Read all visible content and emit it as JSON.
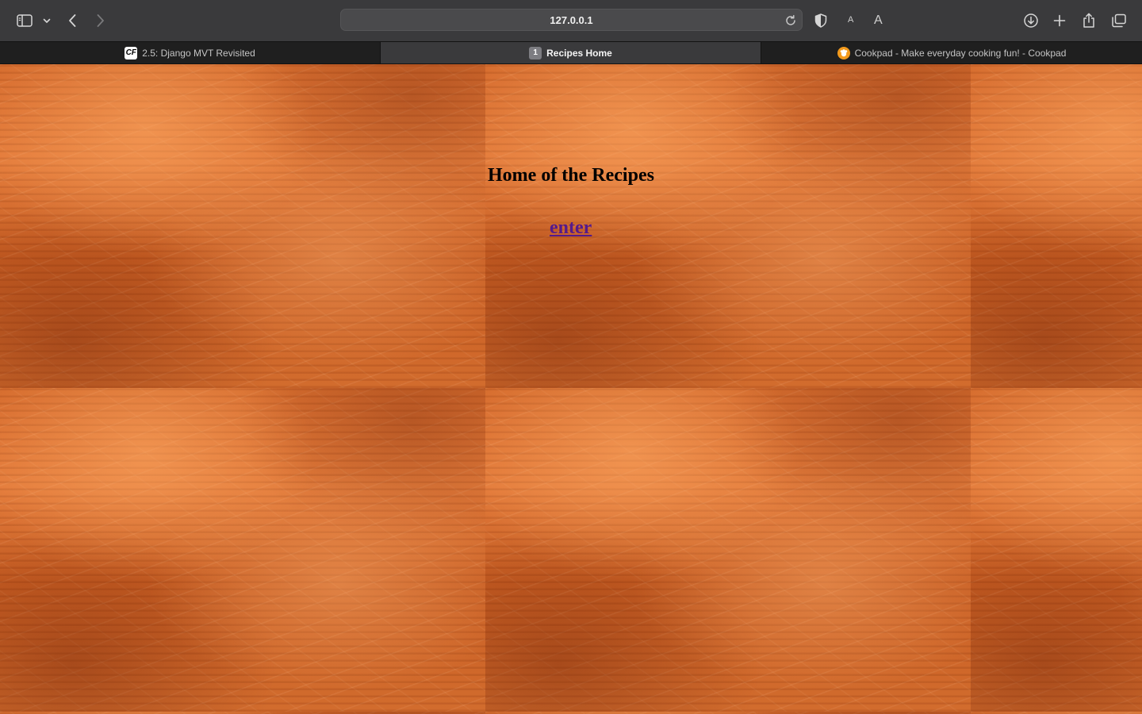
{
  "browser": {
    "address": "127.0.0.1",
    "font_small": "A",
    "font_large": "A"
  },
  "tabs": [
    {
      "label": "2.5: Django MVT Revisited",
      "favicon": "CF",
      "active": false
    },
    {
      "label": "Recipes Home",
      "favicon": "1",
      "active": true
    },
    {
      "label": "Cookpad - Make everyday cooking fun! - Cookpad",
      "favicon": "cookpad-icon",
      "active": false
    }
  ],
  "page": {
    "title": "Home of the Recipes",
    "enter_link": "enter",
    "link_color": "#551a8b"
  }
}
